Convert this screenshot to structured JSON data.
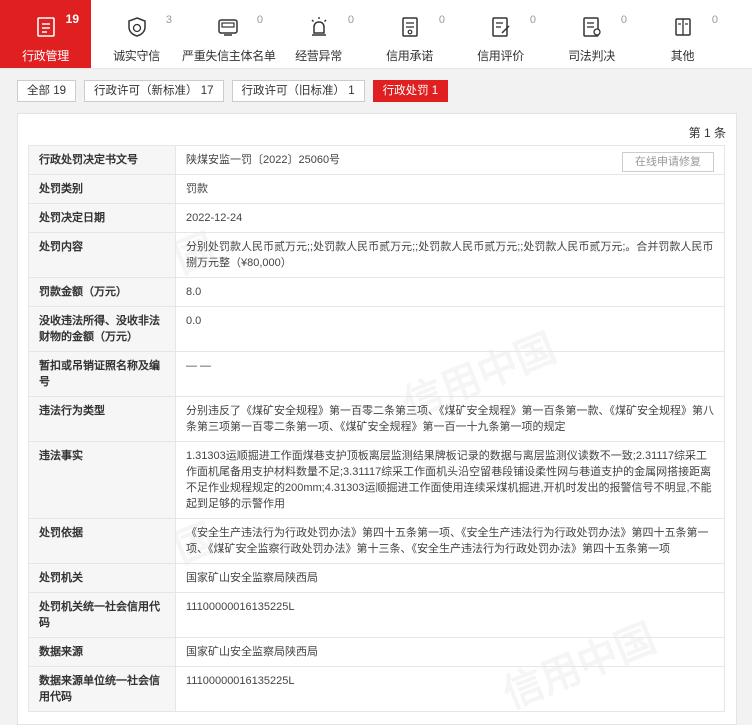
{
  "nav": [
    {
      "label": "行政管理",
      "count": "19",
      "icon": "doc-list-icon",
      "active": true
    },
    {
      "label": "诚实守信",
      "count": "3",
      "icon": "shield-check-icon",
      "active": false
    },
    {
      "label": "严重失信主体名单",
      "count": "0",
      "icon": "blacklist-icon",
      "active": false
    },
    {
      "label": "经营异常",
      "count": "0",
      "icon": "alarm-icon",
      "active": false
    },
    {
      "label": "信用承诺",
      "count": "0",
      "icon": "promise-doc-icon",
      "active": false
    },
    {
      "label": "信用评价",
      "count": "0",
      "icon": "evaluation-icon",
      "active": false
    },
    {
      "label": "司法判决",
      "count": "0",
      "icon": "judgement-icon",
      "active": false
    },
    {
      "label": "其他",
      "count": "0",
      "icon": "book-icon",
      "active": false
    }
  ],
  "subtabs": [
    {
      "label": "全部  19",
      "active": false
    },
    {
      "label": "行政许可（新标准）  17",
      "active": false
    },
    {
      "label": "行政许可（旧标准）  1",
      "active": false
    },
    {
      "label": "行政处罚  1",
      "active": true
    }
  ],
  "page_label": "第 1 条",
  "repair_button": "在线申请修复",
  "watermark": "信用中国",
  "colors": {
    "accent": "#e02020"
  },
  "rows": [
    {
      "key": "行政处罚决定书文号",
      "value": "陕煤安监一罚〔2022〕25060号"
    },
    {
      "key": "处罚类别",
      "value": "罚款"
    },
    {
      "key": "处罚决定日期",
      "value": "2022-12-24"
    },
    {
      "key": "处罚内容",
      "value": "分别处罚款人民币贰万元;;处罚款人民币贰万元;;处罚款人民币贰万元;;处罚款人民币贰万元;。合并罚款人民币捌万元整（¥80,000）"
    },
    {
      "key": "罚款金额（万元）",
      "value": "8.0"
    },
    {
      "key": "没收违法所得、没收非法财物的金额（万元）",
      "value": "0.0"
    },
    {
      "key": "暂扣或吊销证照名称及编号",
      "value": "— —"
    },
    {
      "key": "违法行为类型",
      "value": "分别违反了《煤矿安全规程》第一百零二条第三项、《煤矿安全规程》第一百条第一款、《煤矿安全规程》第八条第三项第一百零二条第一项、《煤矿安全规程》第一百一十九条第一项的规定"
    },
    {
      "key": "违法事实",
      "value": "1.31303运顺掘进工作面煤巷支护顶板离层监测结果牌板记录的数据与离层监测仪读数不一致;2.31117综采工作面机尾备用支护材料数量不足;3.31117综采工作面机头沿空留巷段铺设柔性网与巷道支护的金属网搭接距离不足作业规程规定的200mm;4.31303运顺掘进工作面使用连续采煤机掘进,开机时发出的报警信号不明显,不能起到足够的示警作用"
    },
    {
      "key": "处罚依据",
      "value": "《安全生产违法行为行政处罚办法》第四十五条第一项、《安全生产违法行为行政处罚办法》第四十五条第一项、《煤矿安全监察行政处罚办法》第十三条、《安全生产违法行为行政处罚办法》第四十五条第一项"
    },
    {
      "key": "处罚机关",
      "value": "国家矿山安全监察局陕西局"
    },
    {
      "key": "处罚机关统一社会信用代码",
      "value": "11100000016135225L"
    },
    {
      "key": "数据来源",
      "value": "国家矿山安全监察局陕西局"
    },
    {
      "key": "数据来源单位统一社会信用代码",
      "value": "11100000016135225L"
    }
  ]
}
